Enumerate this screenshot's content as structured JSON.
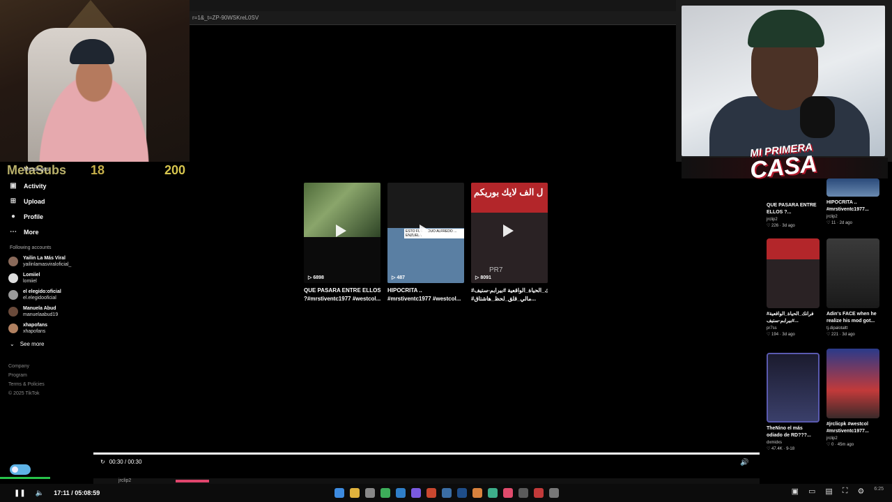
{
  "overlay": {
    "subs_label": "MetaSubs",
    "subs_count": "18",
    "subs_goal": "200",
    "logo_line1": "MI PRIMERA",
    "logo_line2": "CASA"
  },
  "browser": {
    "url": "r=1&_t=ZP-90WSKreL0SV"
  },
  "sidebar": {
    "messages_label": "Messages",
    "nav": [
      {
        "label": "Activity",
        "icon": "inbox-icon"
      },
      {
        "label": "Upload",
        "icon": "plus-square-icon"
      },
      {
        "label": "Profile",
        "icon": "avatar-icon"
      },
      {
        "label": "More",
        "icon": "ellipsis-icon"
      }
    ],
    "following_title": "Following accounts",
    "accounts": [
      {
        "name": "Yailin La Más Viral",
        "handle": "yailinlamasviraloficial_"
      },
      {
        "name": "Lomiiel",
        "handle": "lomiiel"
      },
      {
        "name": "el elegido:oficial",
        "handle": "el.elegidooficial"
      },
      {
        "name": "Manuela Abud",
        "handle": "manuelaabud19"
      },
      {
        "name": "xhapofans",
        "handle": "xhapofans"
      }
    ],
    "see_more": "See more",
    "footer": [
      "Company",
      "Program",
      "Terms & Policies",
      "© 2025 TikTok"
    ]
  },
  "cards": [
    {
      "views": "6898",
      "title": "QUE PASARA ENTRE ELLOS",
      "title2": "?#mrstiventc1977 #westcol..."
    },
    {
      "views": "487",
      "title": "HIPOCRITA ..",
      "title2": "#mrstiventc1977 #westcol..."
    },
    {
      "views": "8091",
      "title": "#فرانك_الحياة_الواقعية #بيرابم-ستيف",
      "title2": "#مالي_قلق_لحظ_هاشتاق...",
      "arabic_head": "ل الف لايك بوريكم",
      "pr7": "PR7"
    }
  ],
  "card2_overlay": "ESTO FUE ... DUO ALFREDO ... ENZUELA",
  "right_grid": [
    {
      "title": "QUE PASARA ENTRE ELLOS ?...",
      "author": "jrclip2",
      "likes": "226",
      "age": "3d ago"
    },
    {
      "title": "HIPOCRITA .. #mrstiventc1977...",
      "author": "jrclip2",
      "likes": "11",
      "age": "2d ago"
    },
    {
      "title": "#فرانك_الحياة_الواقعية #بيرابم-ستيف...",
      "author": "pr7ss",
      "likes": "194",
      "age": "3d ago"
    },
    {
      "title": "Adin's FACE when he realize his mod got...",
      "author": "tj.dipalotaltt",
      "likes": "221",
      "age": "3d ago"
    },
    {
      "title": "TheNino el más odiado de RD???...",
      "author": "dxmidxs",
      "likes": "47.4K",
      "age": "9-18"
    },
    {
      "title": "#jrclicpk #westcol #mrstiventc1977...",
      "author": "jrclip2",
      "likes": "0",
      "age": "45m ago"
    }
  ],
  "player": {
    "time": "00:30 / 00:30",
    "progress": 1.0,
    "strip_label": "jrclip2"
  },
  "taskbar": {
    "stream_time": "17:11 / 05:08:59",
    "clock": "6:25"
  },
  "colors": {
    "accent_green": "#27c24a",
    "accent_pink": "#e0456c",
    "toggle_blue": "#5eb3e6"
  }
}
